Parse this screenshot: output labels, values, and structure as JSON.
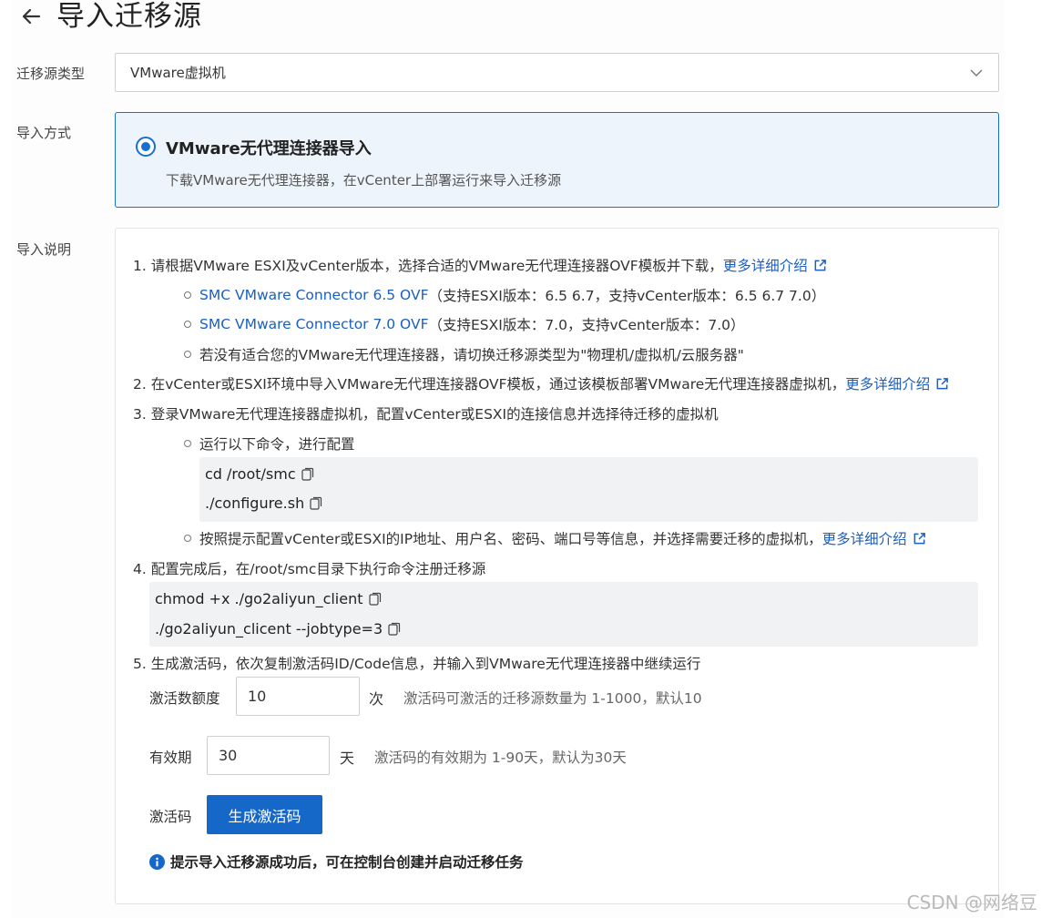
{
  "header": {
    "title": "导入迁移源"
  },
  "source_type": {
    "label": "迁移源类型",
    "value": "VMware虚拟机"
  },
  "import_method": {
    "label": "导入方式",
    "option_title": "VMware无代理连接器导入",
    "option_desc": "下载VMware无代理连接器，在vCenter上部署运行来导入迁移源"
  },
  "instructions": {
    "label": "导入说明",
    "step1": {
      "text": "1. 请根据VMware ESXI及vCenter版本，选择合适的VMware无代理连接器OVF模板并下载，",
      "link": "更多详细介绍"
    },
    "ovf65": {
      "link": "SMC VMware Connector 6.5 OVF",
      "note": "（支持ESXI版本：6.5 6.7，支持vCenter版本：6.5 6.7 7.0）"
    },
    "ovf70": {
      "link": "SMC VMware Connector 7.0 OVF",
      "note": "（支持ESXI版本：7.0，支持vCenter版本：7.0）"
    },
    "no_match": "若没有适合您的VMware无代理连接器，请切换迁移源类型为\"物理机/虚拟机/云服务器\"",
    "step2": {
      "text": "2. 在vCenter或ESXI环境中导入VMware无代理连接器OVF模板，通过该模板部署VMware无代理连接器虚拟机，",
      "link": "更多详细介绍"
    },
    "step3": "3. 登录VMware无代理连接器虚拟机，配置vCenter或ESXI的连接信息并选择待迁移的虚拟机",
    "step3_run": "运行以下命令，进行配置",
    "cmd1": "cd /root/smc",
    "cmd2": "./configure.sh",
    "step3_config": {
      "text": "按照提示配置vCenter或ESXI的IP地址、用户名、密码、端口号等信息，并选择需要迁移的虚拟机，",
      "link": "更多详细介绍"
    },
    "step4": "4. 配置完成后，在/root/smc目录下执行命令注册迁移源",
    "cmd3": "chmod +x ./go2aliyun_client",
    "cmd4": "./go2aliyun_clicent --jobtype=3",
    "step5": "5. 生成激活码，依次复制激活码ID/Code信息，并输入到VMware无代理连接器中继续运行"
  },
  "activation": {
    "quota_label": "激活数额度",
    "quota_value": "10",
    "quota_unit": "次",
    "quota_hint": "激活码可激活的迁移源数量为 1-1000，默认10",
    "validity_label": "有效期",
    "validity_value": "30",
    "validity_unit": "天",
    "validity_hint": "激活码的有效期为 1-90天，默认为30天",
    "code_label": "激活码",
    "generate_button": "生成激活码",
    "tip": "提示导入迁移源成功后，可在控制台创建并启动迁移任务"
  },
  "watermark": "CSDN @网络豆",
  "colors": {
    "primary": "#1567c8",
    "link": "#1a5fc1",
    "selected_bg": "#eef4fb",
    "code_bg": "#f1f2f4"
  },
  "icons": [
    "back-arrow-icon",
    "chevron-down-icon",
    "radio-selected-icon",
    "external-link-icon",
    "copy-icon",
    "info-icon"
  ]
}
